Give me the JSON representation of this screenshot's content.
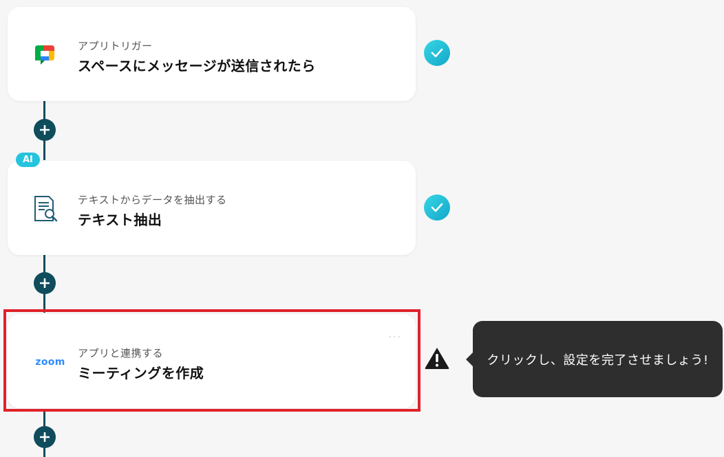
{
  "steps": [
    {
      "subtitle": "アプリトリガー",
      "title": "スペースにメッセージが送信されたら",
      "icon": "google-chat-icon",
      "status": "complete"
    },
    {
      "badge": "AI",
      "subtitle": "テキストからデータを抽出する",
      "title": "テキスト抽出",
      "icon": "document-search-icon",
      "status": "complete"
    },
    {
      "subtitle": "アプリと連携する",
      "title": "ミーティングを作成",
      "icon": "zoom-icon",
      "icon_text": "zoom",
      "status": "warning"
    }
  ],
  "tooltip": {
    "text": "クリックし、設定を完了させましょう!"
  },
  "colors": {
    "accent": "#0f4c5c",
    "check": "#14a7c9",
    "highlight": "#e0222a",
    "ai_badge": "#25c3dd"
  }
}
